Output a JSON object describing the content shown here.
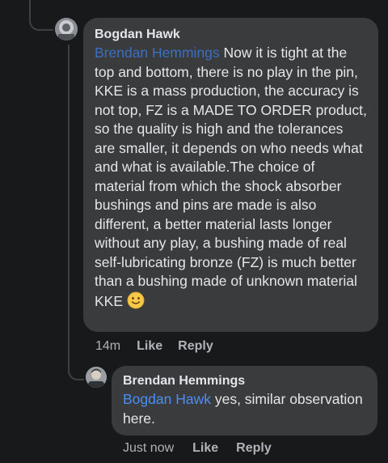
{
  "top_clipped": {
    "text": "..."
  },
  "comments": [
    {
      "author": "Bogdan Hawk",
      "mention": "Brendan Hemmings",
      "text": " Now it is tight at the top and bottom, there is no play in the pin, KKE is a mass production, the accuracy is not top, FZ is a MADE TO ORDER product, so the quality is high and the tolerances are smaller, it depends on who needs what and what is available.The choice of material from which the shock absorber bushings and pins are made is also different, a better material lasts longer without any play, a bushing made of real self-lubricating bronze (FZ) is much better than a bushing made of unknown material KKE ",
      "emoji": "slightly-smiling-face",
      "time": "14m",
      "like": "Like",
      "reply": "Reply"
    },
    {
      "author": "Brendan Hemmings",
      "mention": "Bogdan Hawk",
      "text": " yes, similar observation here.",
      "time": "Just now",
      "like": "Like",
      "reply": "Reply"
    }
  ],
  "colors": {
    "background": "#18191a",
    "bubble": "#3a3b3c",
    "mention": "#4a8ef5",
    "secondary_text": "#b0b3b8"
  }
}
